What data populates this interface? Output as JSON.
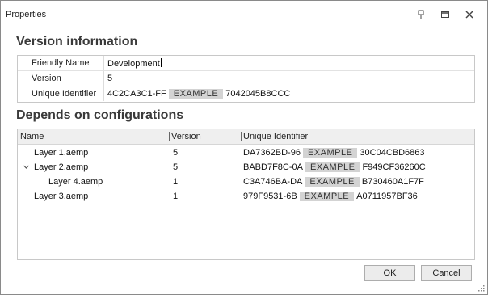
{
  "window": {
    "title": "Properties"
  },
  "version_section": {
    "heading": "Version information",
    "rows": [
      {
        "label": "Friendly Name",
        "value": "Development"
      },
      {
        "label": "Version",
        "value": "5"
      },
      {
        "label": "Unique Identifier",
        "value_prefix": "4C2CA3C1-FF",
        "masked": "EXAMPLE",
        "value_suffix": "7042045B8CCC"
      }
    ]
  },
  "depends_section": {
    "heading": "Depends on configurations",
    "columns": [
      "Name",
      "Version",
      "Unique Identifier"
    ],
    "rows": [
      {
        "name": "Layer 1.aemp",
        "version": "5",
        "id_prefix": "DA7362BD-96",
        "masked": "EXAMPLE",
        "id_suffix": "30C04CBD6863",
        "expanded": null,
        "level": 0
      },
      {
        "name": "Layer 2.aemp",
        "version": "5",
        "id_prefix": "BABD7F8C-0A",
        "masked": "EXAMPLE",
        "id_suffix": "F949CF36260C",
        "expanded": true,
        "level": 0
      },
      {
        "name": "Layer 4.aemp",
        "version": "1",
        "id_prefix": "C3A746BA-DA",
        "masked": "EXAMPLE",
        "id_suffix": "B730460A1F7F",
        "expanded": null,
        "level": 1
      },
      {
        "name": "Layer 3.aemp",
        "version": "1",
        "id_prefix": "979F9531-6B",
        "masked": "EXAMPLE",
        "id_suffix": "A0711957BF36",
        "expanded": null,
        "level": 0
      }
    ]
  },
  "buttons": {
    "ok": "OK",
    "cancel": "Cancel"
  },
  "icons": {
    "pin": "pin-icon",
    "maximize": "maximize-icon",
    "close": "close-icon",
    "expander": "chevron-down-icon",
    "grip": "resize-grip-icon"
  }
}
